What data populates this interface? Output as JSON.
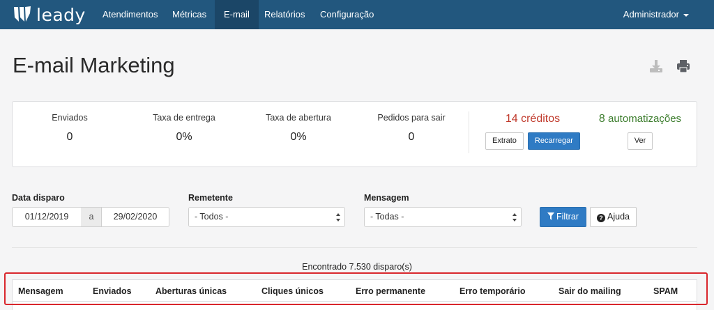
{
  "app": {
    "logo_text": "leady"
  },
  "nav": {
    "items": [
      {
        "label": "Atendimentos"
      },
      {
        "label": "Métricas"
      },
      {
        "label": "E-mail"
      },
      {
        "label": "Relatórios"
      },
      {
        "label": "Configuração"
      }
    ],
    "active_index": 2,
    "user_label": "Administrador"
  },
  "page": {
    "title": "E-mail Marketing",
    "icons": [
      "download-icon",
      "print-icon"
    ]
  },
  "stats": [
    {
      "label": "Enviados",
      "value": "0"
    },
    {
      "label": "Taxa de entrega",
      "value": "0%"
    },
    {
      "label": "Taxa de abertura",
      "value": "0%"
    },
    {
      "label": "Pedidos para sair",
      "value": "0"
    }
  ],
  "credits": {
    "label": "14 créditos",
    "extrato_label": "Extrato",
    "recarregar_label": "Recarregar"
  },
  "automations": {
    "count": "8",
    "label": "automatizações",
    "ver_label": "Ver"
  },
  "filters": {
    "date_label": "Data disparo",
    "date_from": "01/12/2019",
    "date_sep": "a",
    "date_to": "29/02/2020",
    "sender_label": "Remetente",
    "sender_value": "- Todos -",
    "message_label": "Mensagem",
    "message_value": "- Todas -",
    "filter_button": "Filtrar",
    "help_button": "Ajuda"
  },
  "results": {
    "found_text": "Encontrado 7.530 disparo(s)"
  },
  "table": {
    "columns": [
      "Mensagem",
      "Enviados",
      "Aberturas únicas",
      "Cliques únicos",
      "Erro permanente",
      "Erro temporário",
      "Sair do mailing",
      "SPAM"
    ]
  },
  "colors": {
    "navbar": "#22577e",
    "navbar_active": "#1b4667",
    "primary_button": "#2f7bc4",
    "credits_text": "#c0392b",
    "automations_text": "#3c7d2d",
    "highlight_border": "#d9262c"
  }
}
